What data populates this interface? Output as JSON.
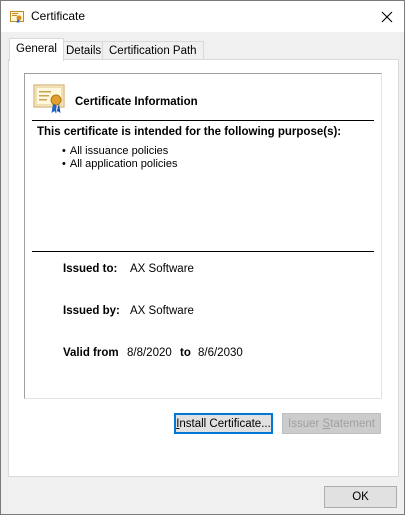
{
  "window": {
    "title": "Certificate",
    "icon": "certificate-icon",
    "close_icon": "close-icon"
  },
  "tabs": [
    {
      "label": "General",
      "active": true
    },
    {
      "label": "Details",
      "active": false
    },
    {
      "label": "Certification Path",
      "active": false
    }
  ],
  "general": {
    "header": "Certificate Information",
    "purpose_heading": "This certificate is intended for the following purpose(s):",
    "purposes": [
      "All issuance policies",
      "All application policies"
    ],
    "issued_to_label": "Issued to:",
    "issued_to_value": "AX Software",
    "issued_by_label": "Issued by:",
    "issued_by_value": "AX Software",
    "valid_from_label": "Valid from",
    "valid_from_value": "8/8/2020",
    "valid_to_label": "to",
    "valid_to_value": "8/6/2030"
  },
  "buttons": {
    "install": {
      "prefix": "",
      "mnemonic": "I",
      "rest": "nstall Certificate..."
    },
    "issuer": {
      "prefix": "Issuer ",
      "mnemonic": "S",
      "rest": "tatement"
    },
    "ok": "OK"
  },
  "colors": {
    "accent": "#0078d7",
    "panel": "#ffffff",
    "dialog": "#f0f0f0"
  }
}
